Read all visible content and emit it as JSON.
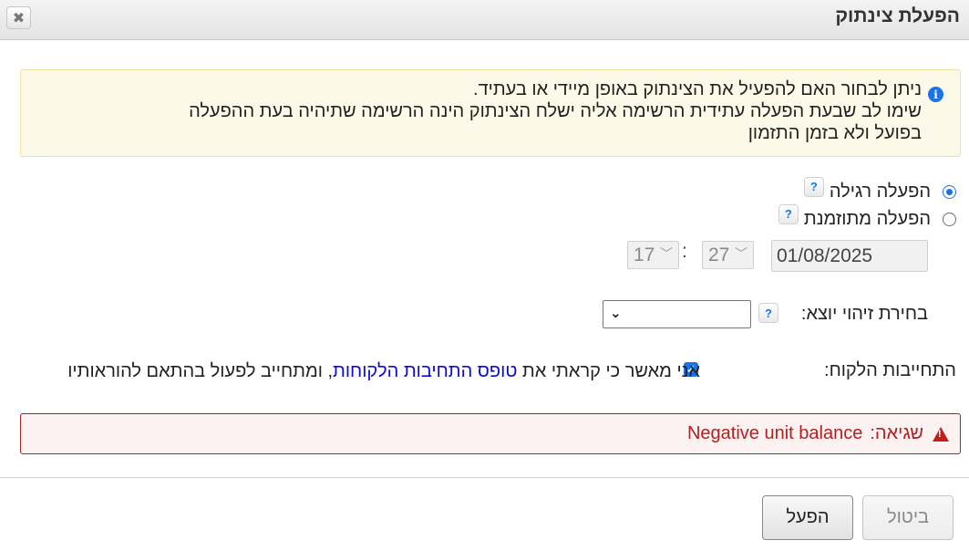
{
  "dialog": {
    "title": "הפעלת צינתוק",
    "close_symbol": "✖"
  },
  "info": {
    "icon": "info-icon",
    "line1": "ניתן לבחור האם להפעיל את הצינתוק באופן מיידי או בעתיד.",
    "line2": "שימו לב שבעת הפעלה עתידית הרשימה אליה ישלח הצינתוק הינה הרשימה שתיהיה בעת ההפעלה",
    "line3": "בפועל ולא בזמן התזמון"
  },
  "options": {
    "regular": {
      "label": "הפעלה רגילה",
      "selected": true,
      "help": "?"
    },
    "scheduled": {
      "label": "הפעלה מתוזמנת",
      "selected": false,
      "help": "?"
    }
  },
  "schedule": {
    "date": "01/08/2025",
    "hour": "17",
    "minute": "27",
    "separator": ":"
  },
  "sender": {
    "label": "בחירת זיהוי יוצא:",
    "help": "?",
    "value": ""
  },
  "commitment": {
    "label": "התחייבות הלקוח:",
    "checked": true,
    "text_before": "אני מאשר כי קראתי את ",
    "link": "טופס התחיבות הלקוחות",
    "text_after": ", ומתחייב לפעול בהתאם להוראותיו"
  },
  "error": {
    "label": "שגיאה:",
    "message": "Negative unit balance"
  },
  "buttons": {
    "activate": "הפעל",
    "cancel": "ביטול"
  },
  "colors": {
    "accent": "#1a73e8",
    "error": "#b21f1f",
    "info_bg": "#fdf9e8",
    "link": "#0a0ad8"
  }
}
